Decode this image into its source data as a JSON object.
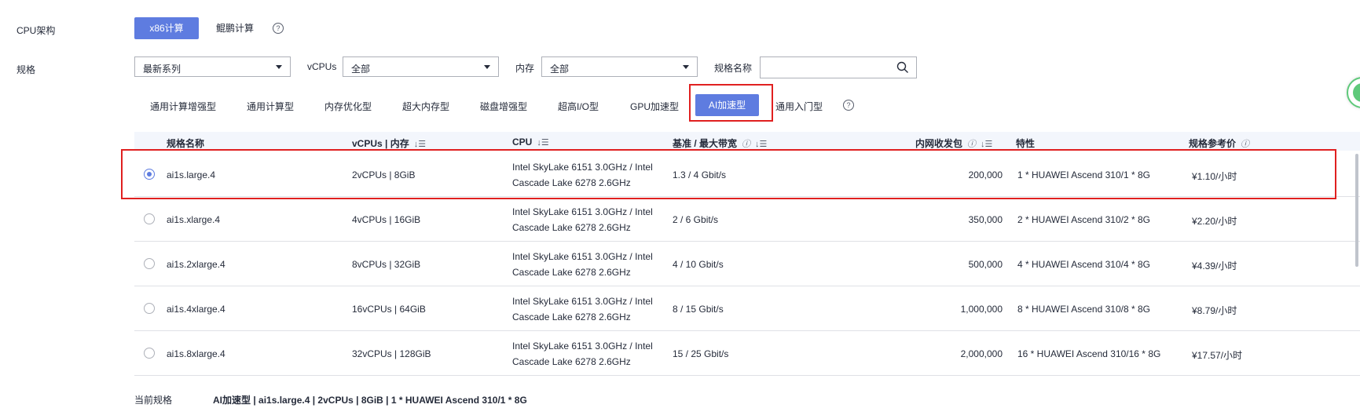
{
  "cpu_arch": {
    "label": "CPU架构",
    "options": [
      "x86计算",
      "鲲鹏计算"
    ],
    "selected": "x86计算"
  },
  "spec": {
    "label": "规格",
    "series_select": "最新系列",
    "vcpus_label": "vCPUs",
    "vcpus_select": "全部",
    "memory_label": "内存",
    "memory_select": "全部",
    "name_label": "规格名称",
    "name_placeholder": ""
  },
  "categories": [
    "通用计算增强型",
    "通用计算型",
    "内存优化型",
    "超大内存型",
    "磁盘增强型",
    "超高I/O型",
    "GPU加速型",
    "AI加速型",
    "通用入门型"
  ],
  "selected_category": "AI加速型",
  "table": {
    "headers": [
      "规格名称",
      "vCPUs | 内存",
      "CPU",
      "基准 / 最大带宽",
      "内网收发包",
      "特性",
      "规格参考价"
    ],
    "rows": [
      {
        "name": "ai1s.large.4",
        "vcpu_mem": "2vCPUs | 8GiB",
        "cpu_line1": "Intel SkyLake 6151 3.0GHz / Intel",
        "cpu_line2": "Cascade Lake 6278 2.6GHz",
        "bandwidth": "1.3 / 4 Gbit/s",
        "pps": "200,000",
        "feature": "1 * HUAWEI Ascend 310/1 * 8G",
        "price": "¥1.10/小时",
        "selected": true
      },
      {
        "name": "ai1s.xlarge.4",
        "vcpu_mem": "4vCPUs | 16GiB",
        "cpu_line1": "Intel SkyLake 6151 3.0GHz / Intel",
        "cpu_line2": "Cascade Lake 6278 2.6GHz",
        "bandwidth": "2 / 6 Gbit/s",
        "pps": "350,000",
        "feature": "2 * HUAWEI Ascend 310/2 * 8G",
        "price": "¥2.20/小时",
        "selected": false
      },
      {
        "name": "ai1s.2xlarge.4",
        "vcpu_mem": "8vCPUs | 32GiB",
        "cpu_line1": "Intel SkyLake 6151 3.0GHz / Intel",
        "cpu_line2": "Cascade Lake 6278 2.6GHz",
        "bandwidth": "4 / 10 Gbit/s",
        "pps": "500,000",
        "feature": "4 * HUAWEI Ascend 310/4 * 8G",
        "price": "¥4.39/小时",
        "selected": false
      },
      {
        "name": "ai1s.4xlarge.4",
        "vcpu_mem": "16vCPUs | 64GiB",
        "cpu_line1": "Intel SkyLake 6151 3.0GHz / Intel",
        "cpu_line2": "Cascade Lake 6278 2.6GHz",
        "bandwidth": "8 / 15 Gbit/s",
        "pps": "1,000,000",
        "feature": "8 * HUAWEI Ascend 310/8 * 8G",
        "price": "¥8.79/小时",
        "selected": false
      },
      {
        "name": "ai1s.8xlarge.4",
        "vcpu_mem": "32vCPUs | 128GiB",
        "cpu_line1": "Intel SkyLake 6151 3.0GHz / Intel",
        "cpu_line2": "Cascade Lake 6278 2.6GHz",
        "bandwidth": "15 / 25 Gbit/s",
        "pps": "2,000,000",
        "feature": "16 * HUAWEI Ascend 310/16 * 8G",
        "price": "¥17.57/小时",
        "selected": false
      }
    ]
  },
  "current_spec": {
    "label": "当前规格",
    "value": "AI加速型 | ai1s.large.4 | 2vCPUs | 8GiB | 1 * HUAWEI Ascend 310/1 * 8G"
  },
  "colors": {
    "accent": "#5e7ce0",
    "highlight": "#e02020",
    "header_bg": "#f3f6fc"
  }
}
